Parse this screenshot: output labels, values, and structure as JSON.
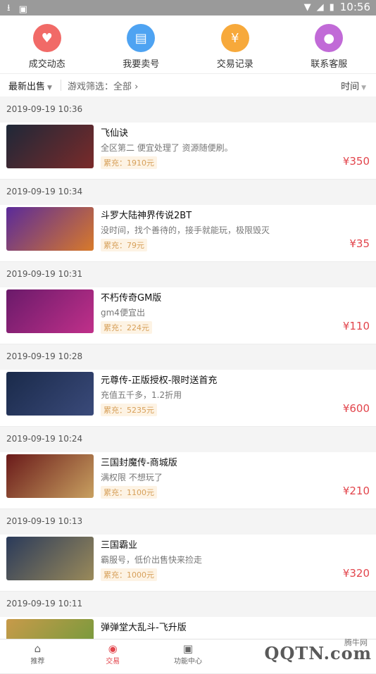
{
  "status_bar": {
    "time": "10:56"
  },
  "quick_nav": [
    {
      "label": "成交动态",
      "icon": "handshake-icon",
      "color": "#f16a67",
      "glyph": "♥"
    },
    {
      "label": "我要卖号",
      "icon": "shop-icon",
      "color": "#4ea3f2",
      "glyph": "▤"
    },
    {
      "label": "交易记录",
      "icon": "wallet-icon",
      "color": "#f7a93b",
      "glyph": "¥"
    },
    {
      "label": "联系客服",
      "icon": "service-icon",
      "color": "#c16ad7",
      "glyph": "●"
    }
  ],
  "filter_bar": {
    "sort_label": "最新出售",
    "game_filter_label": "游戏筛选：全部",
    "time_label": "时间"
  },
  "listings": [
    {
      "date": "2019-09-19 10:36",
      "name": "飞仙诀",
      "desc": "全区第二 便宜处理了 资源随便刷。",
      "recharge": "累充：1910元",
      "price": "¥350",
      "thumb": [
        "#1e2838",
        "#7a2a2a"
      ]
    },
    {
      "date": "2019-09-19 10:34",
      "name": "斗罗大陆神界传说2BT",
      "desc": "没时间，找个善待的，接手就能玩，极限毁灭",
      "recharge": "累充：79元",
      "price": "¥35",
      "thumb": [
        "#5a2a9a",
        "#d87a2a"
      ]
    },
    {
      "date": "2019-09-19 10:31",
      "name": "不朽传奇GM版",
      "desc": "gm4便宜出",
      "recharge": "累充：224元",
      "price": "¥110",
      "thumb": [
        "#6a1a6a",
        "#c0308a"
      ]
    },
    {
      "date": "2019-09-19 10:28",
      "name": "元尊传-正版授权-限时送首充",
      "desc": "充值五千多，1.2折用",
      "recharge": "累充：5235元",
      "price": "¥600",
      "thumb": [
        "#1a2a4a",
        "#3a4a7a"
      ]
    },
    {
      "date": "2019-09-19 10:24",
      "name": "三国封魔传-商城版",
      "desc": "满权限 不想玩了",
      "recharge": "累充：1100元",
      "price": "¥210",
      "thumb": [
        "#6a1a1a",
        "#c8a060"
      ]
    },
    {
      "date": "2019-09-19 10:13",
      "name": "三国霸业",
      "desc": "霸服号，低价出售快来捡走",
      "recharge": "累充：1000元",
      "price": "¥320",
      "thumb": [
        "#2a3a5a",
        "#9a8a5a"
      ]
    },
    {
      "date": "2019-09-19 10:11",
      "name": "弹弹堂大乱斗-飞升版",
      "desc": "",
      "recharge": "",
      "price": "",
      "thumb": [
        "#c89a4a",
        "#6a9a3a"
      ]
    }
  ],
  "tab_bar": [
    {
      "label": "推荐",
      "icon": "home-icon",
      "glyph": "⌂",
      "active": false
    },
    {
      "label": "交易",
      "icon": "trade-icon",
      "glyph": "◉",
      "active": true
    },
    {
      "label": "功能中心",
      "icon": "treasure-icon",
      "glyph": "▣",
      "active": false
    },
    {
      "label": "",
      "icon": "blank-icon",
      "glyph": "",
      "active": false
    },
    {
      "label": "",
      "icon": "blank-icon",
      "glyph": "",
      "active": false
    }
  ],
  "watermark": {
    "text": "QQTN.com",
    "small_text": "腾牛网"
  }
}
